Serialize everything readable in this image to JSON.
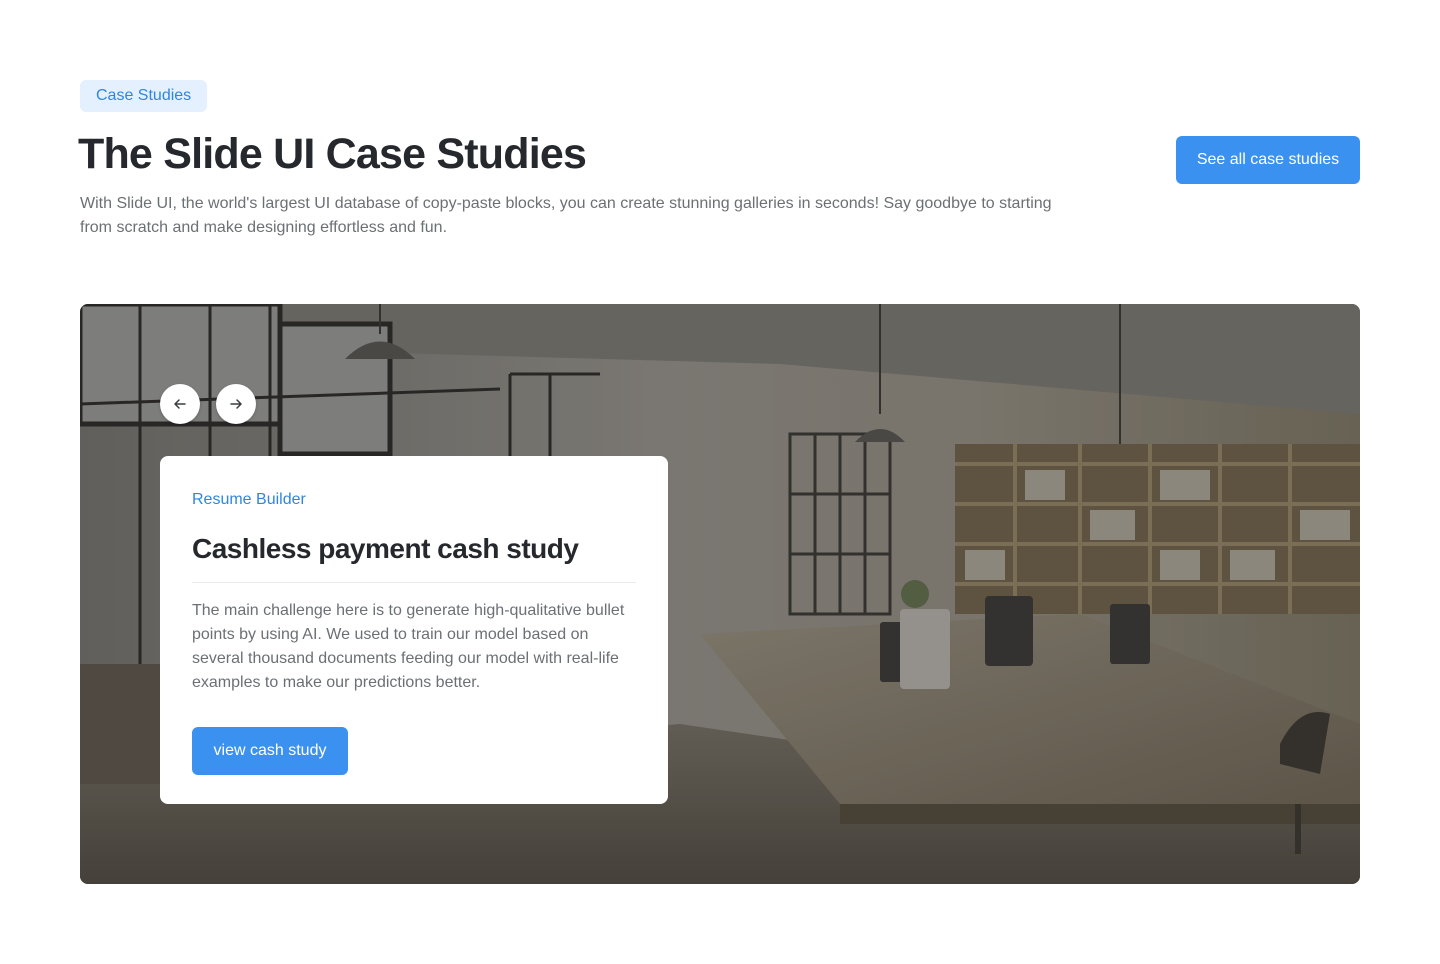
{
  "header": {
    "badge": "Case Studies",
    "title": "The Slide UI Case Studies",
    "subtitle": "With Slide UI, the world's largest UI database of copy-paste blocks, you can create stunning galleries in seconds! Say goodbye to starting from scratch and make designing effortless and fun.",
    "see_all_label": "See all case studies"
  },
  "slider": {
    "prev_icon": "arrow-left-icon",
    "next_icon": "arrow-right-icon",
    "image": "office-interior-photo"
  },
  "card": {
    "category": "Resume Builder",
    "title": "Cashless payment cash study",
    "body": "The main challenge here is to generate high-qualitative bullet points by using AI. We used to train our model based on several thousand documents feeding our model with real-life examples to make our predictions better.",
    "button_label": "view cash study"
  },
  "colors": {
    "accent": "#3b91f0",
    "badge_bg": "#e4f0fd",
    "badge_text": "#2f86e0",
    "heading": "#25282c",
    "muted": "#6b7075"
  }
}
